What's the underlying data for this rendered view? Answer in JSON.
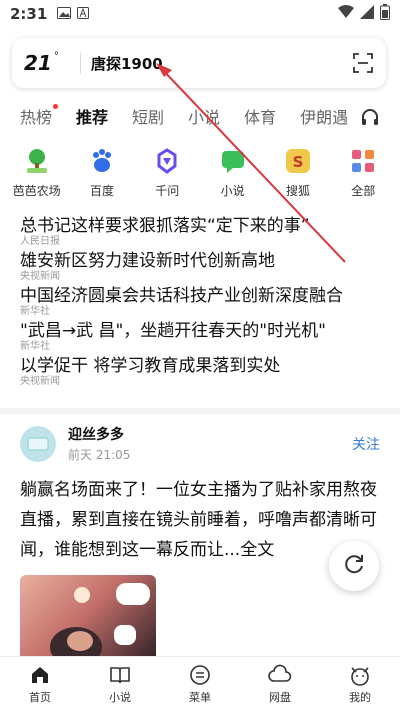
{
  "status_bar": {
    "time": "2:31"
  },
  "search": {
    "weather_temp": "21",
    "weather_deg": "°",
    "query": "唐探1900"
  },
  "tabs": [
    {
      "label": "热榜"
    },
    {
      "label": "推荐"
    },
    {
      "label": "短剧"
    },
    {
      "label": "小说"
    },
    {
      "label": "体育"
    },
    {
      "label": "伊朗遇"
    }
  ],
  "apps": [
    {
      "label": "芭芭农场",
      "color": "#3bb34a"
    },
    {
      "label": "百度",
      "color": "#2f6ee8"
    },
    {
      "label": "千问",
      "color": "#6a4cf0"
    },
    {
      "label": "小说",
      "color": "#3bbf5a"
    },
    {
      "label": "搜狐",
      "color": "#f0c84a"
    },
    {
      "label": "全部",
      "color": "#e85a7a"
    }
  ],
  "news": [
    {
      "title": "总书记这样要求狠抓落实“定下来的事”",
      "source": "人民日报"
    },
    {
      "title": "雄安新区努力建设新时代创新高地",
      "source": "央视新闻"
    },
    {
      "title": "中国经济圆桌会共话科技产业创新深度融合",
      "source": "新华社"
    },
    {
      "title": "\"武昌→武 昌\"，坐趟开往春天的\"时光机\"",
      "source": "新华社"
    },
    {
      "title": "以学促干 将学习教育成果落到实处",
      "source": "央视新闻"
    }
  ],
  "feed": {
    "author": "迎丝多多",
    "time": "前天 21:05",
    "follow_label": "关注",
    "body": "躺赢名场面来了！一位女主播为了贴补家用熬夜直播，累到直接在镜头前睡着，呼噜声都清晰可闻，谁能想到这一幕反而让...全文"
  },
  "bottom_nav": [
    {
      "label": "首页",
      "icon": "home-icon"
    },
    {
      "label": "小说",
      "icon": "book-icon"
    },
    {
      "label": "菜单",
      "icon": "menu-icon"
    },
    {
      "label": "网盘",
      "icon": "cloud-icon"
    },
    {
      "label": "我的",
      "icon": "profile-icon"
    }
  ],
  "colors": {
    "accent_blue": "#3a7bd5",
    "annotation_red": "#d9363e"
  }
}
